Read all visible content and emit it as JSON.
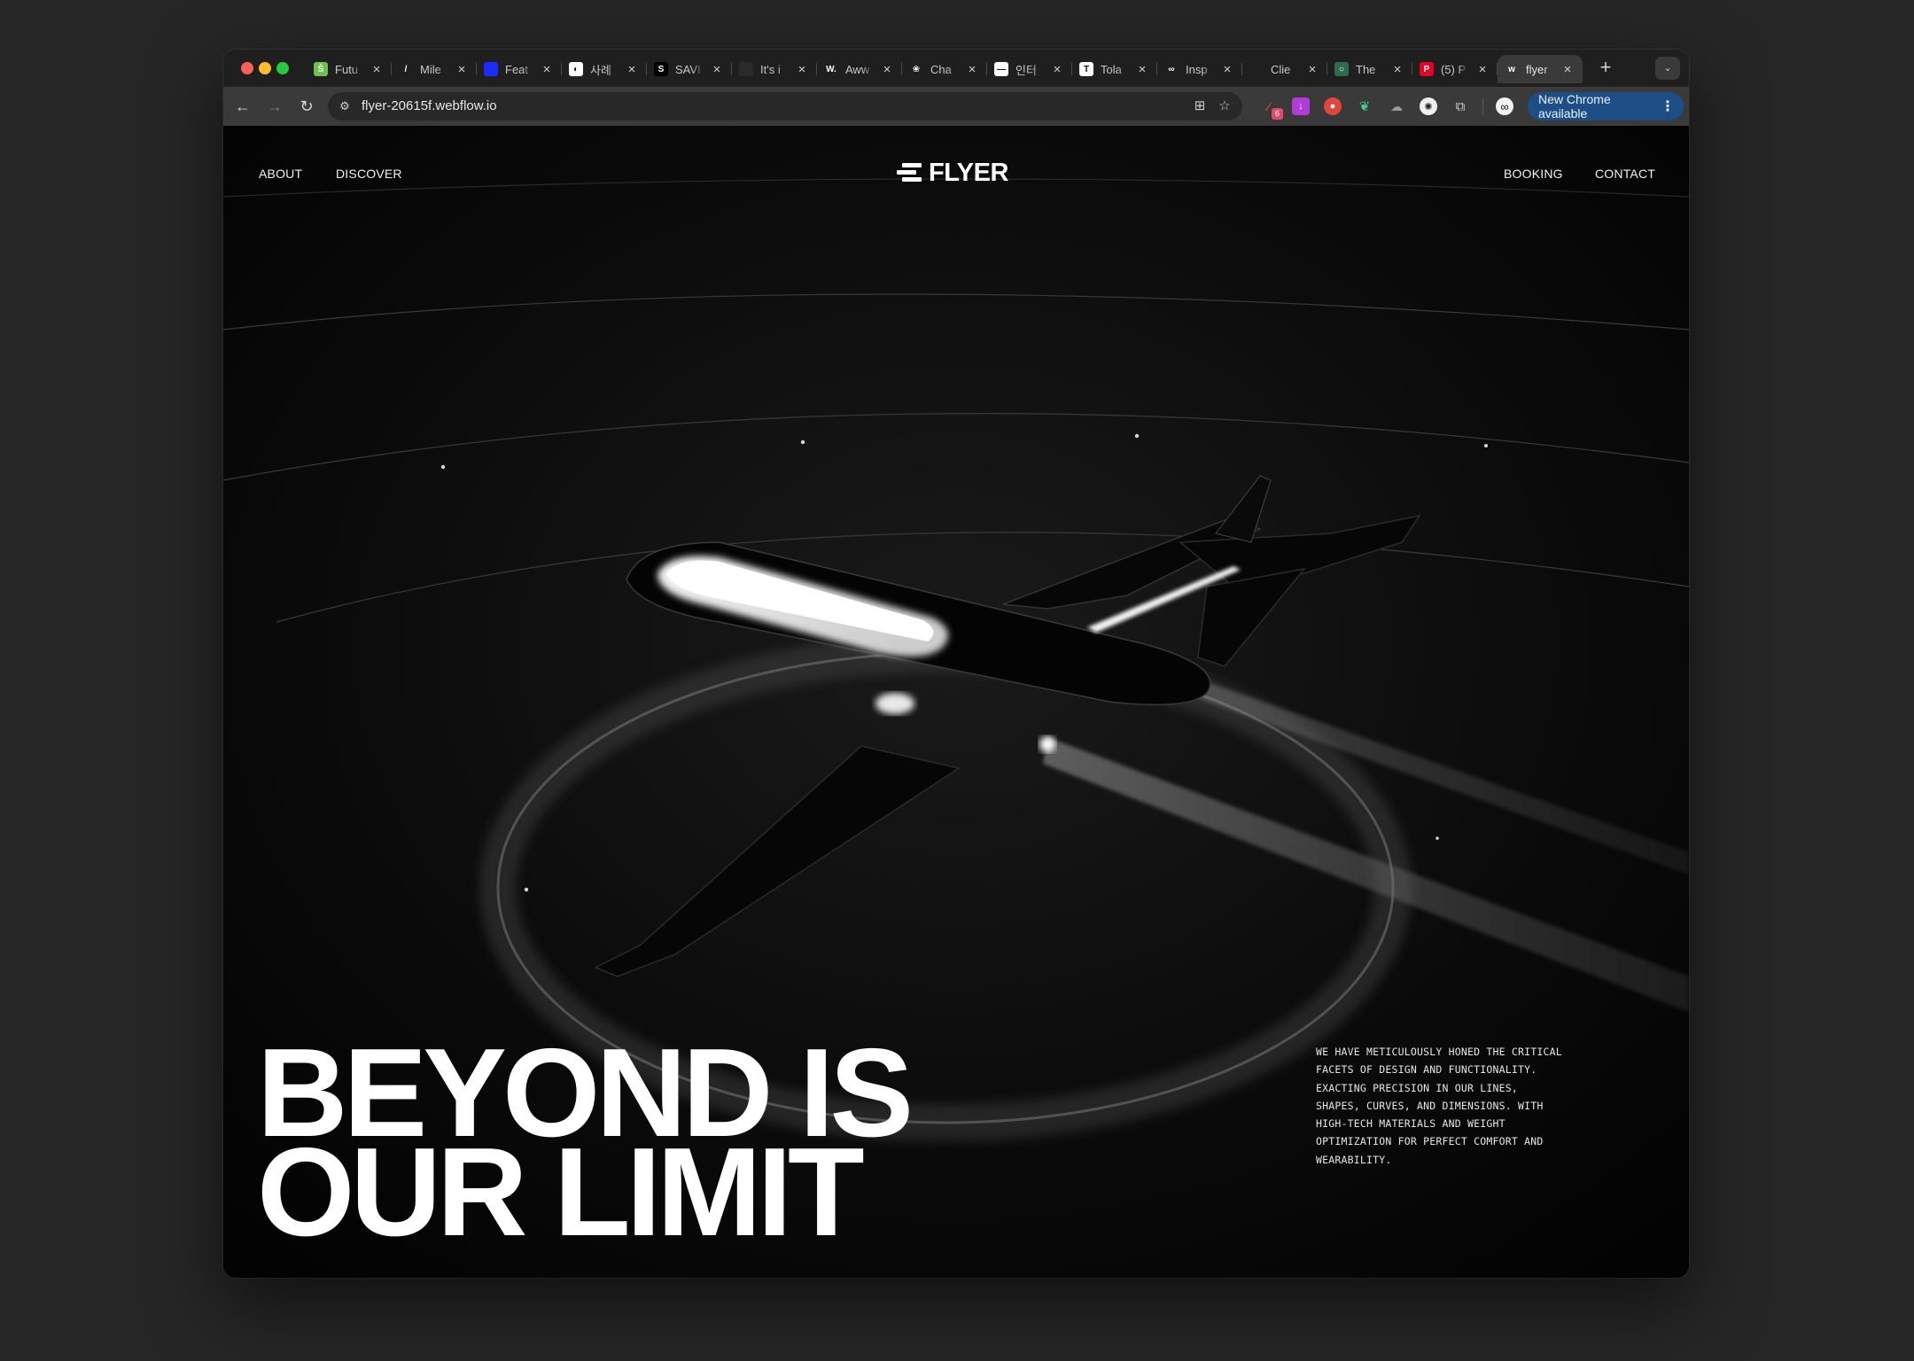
{
  "browser": {
    "tabs": [
      {
        "title": "Futu",
        "favicon": "green-s-icon",
        "color": "#6cc24a",
        "glyph": "Š"
      },
      {
        "title": "Mile",
        "favicon": "slash-icon",
        "color": "#1f1f1f",
        "glyph": "/"
      },
      {
        "title": "Feat",
        "favicon": "blue-square-icon",
        "color": "#1a2cff",
        "glyph": ""
      },
      {
        "title": "사례",
        "favicon": "swirl-icon",
        "color": "#ffffff",
        "glyph": "◐"
      },
      {
        "title": "SAVI",
        "favicon": "s-letter-icon",
        "color": "#000000",
        "glyph": "S"
      },
      {
        "title": "It's i",
        "favicon": "dark-circle-icon",
        "color": "#2a2a2a",
        "glyph": ""
      },
      {
        "title": "Aww",
        "favicon": "w-letter-icon",
        "color": "#1f1f1f",
        "glyph": "W."
      },
      {
        "title": "Cha",
        "favicon": "openai-icon",
        "color": "#1f1f1f",
        "glyph": "❀"
      },
      {
        "title": "인터",
        "favicon": "white-box-icon",
        "color": "#ffffff",
        "glyph": "—"
      },
      {
        "title": "Tola",
        "favicon": "t-letter-icon",
        "color": "#ffffff",
        "glyph": "T"
      },
      {
        "title": "Insp",
        "favicon": "infinity-icon",
        "color": "#1f1f1f",
        "glyph": "∞"
      },
      {
        "title": "Clie",
        "favicon": "dark-dot-icon",
        "color": "#1f1f1f",
        "glyph": ""
      },
      {
        "title": "The",
        "favicon": "green-circle-icon",
        "color": "#2f6b4f",
        "glyph": "○"
      },
      {
        "title": "(5) P",
        "favicon": "pinterest-icon",
        "color": "#e60023",
        "glyph": "P"
      },
      {
        "title": "flyer",
        "favicon": "webflow-icon",
        "color": "#3a3a3a",
        "glyph": "w",
        "active": true
      }
    ],
    "url": "flyer-20615f.webflow.io",
    "extension_badge": "6",
    "update_label": "New Chrome available"
  },
  "site": {
    "nav_left": [
      "ABOUT",
      "DISCOVER"
    ],
    "logo_text": "FLYER",
    "nav_right": [
      "BOOKING",
      "CONTACT"
    ],
    "headline_line1": "BEYOND IS",
    "headline_line2": "OUR LIMIT",
    "blurb_lines": [
      "WE HAVE METICULOUSLY HONED THE CRITICAL",
      "FACETS OF DESIGN AND FUNCTIONALITY.",
      "EXACTING PRECISION IN OUR LINES,",
      "SHAPES, CURVES, AND DIMENSIONS. WITH",
      "HIGH-TECH MATERIALS AND WEIGHT",
      "OPTIMIZATION FOR PERFECT COMFORT AND",
      "WEARABILITY."
    ]
  }
}
